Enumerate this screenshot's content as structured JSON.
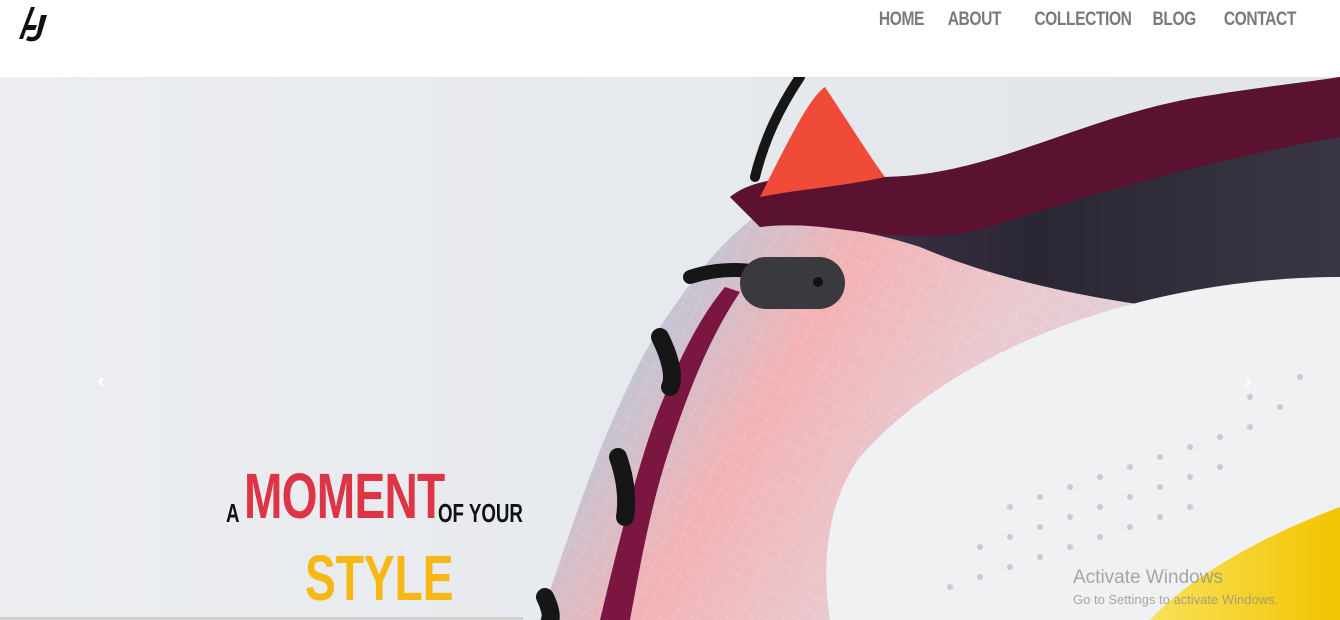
{
  "brand": {
    "logo_icon": "aj-monogram-logo"
  },
  "nav": {
    "items": [
      {
        "label": "HOME"
      },
      {
        "label": "ABOUT"
      },
      {
        "label": "COLLECTION"
      },
      {
        "label": "BLOG"
      },
      {
        "label": "CONTACT"
      }
    ]
  },
  "carousel": {
    "prev_icon": "chevron-left-icon",
    "next_icon": "chevron-right-icon",
    "prev_glyph": "‹",
    "next_glyph": "›"
  },
  "hero": {
    "word_a": "A",
    "word_moment": "MOMENT",
    "word_of_your": "OF YOUR",
    "word_style": "STYLE",
    "colors": {
      "moment": "#dc3545",
      "style": "#f7b714"
    }
  },
  "os_watermark": {
    "title": "Activate Windows",
    "subtitle": "Go to Settings to activate Windows."
  }
}
